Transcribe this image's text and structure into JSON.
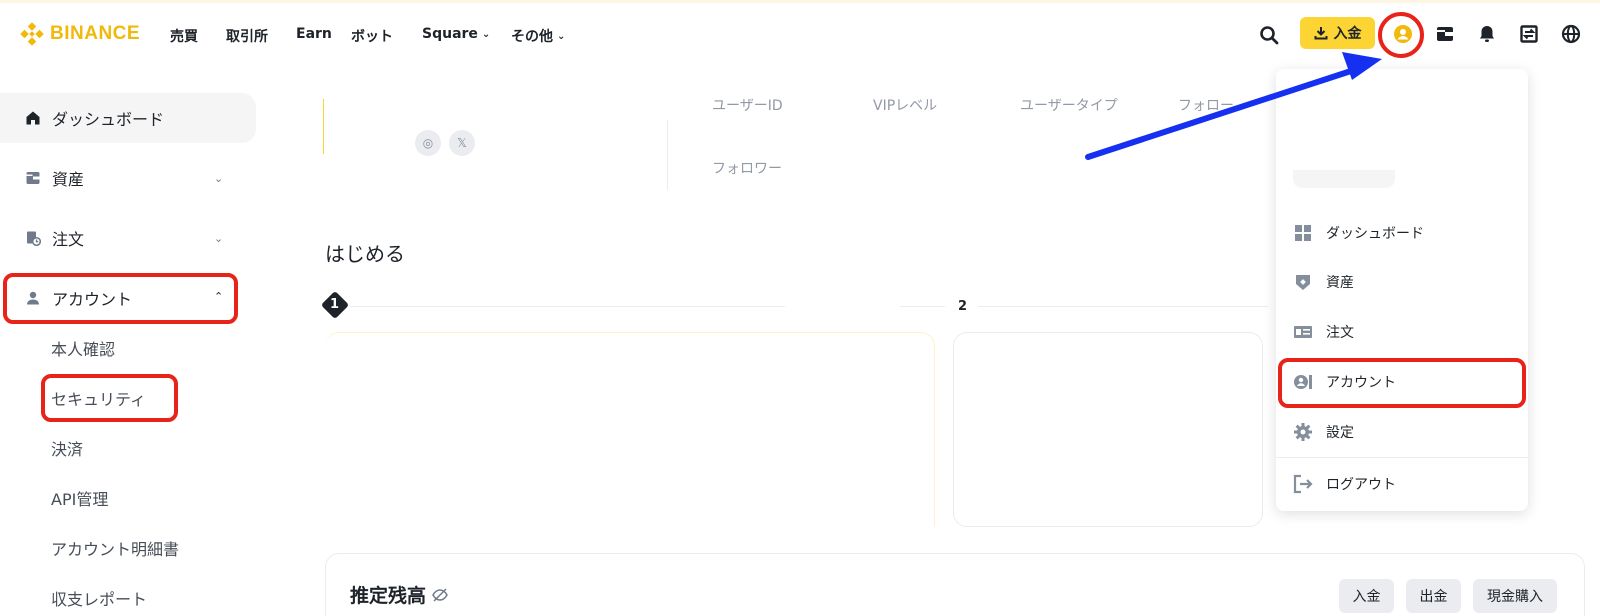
{
  "brand": {
    "name": "BINANCE",
    "color": "#f0b90b"
  },
  "nav": {
    "items": [
      {
        "label": "売買",
        "has_dropdown": false
      },
      {
        "label": "取引所",
        "has_dropdown": false
      },
      {
        "label": "Earn",
        "has_dropdown": false
      },
      {
        "label": "ボット",
        "has_dropdown": false
      },
      {
        "label": "Square",
        "has_dropdown": true
      },
      {
        "label": "その他",
        "has_dropdown": true
      }
    ],
    "deposit_label": "入金",
    "icons": [
      "search-icon",
      "download-icon",
      "user-icon",
      "wallet-icon",
      "bell-icon",
      "transfer-icon",
      "globe-icon"
    ]
  },
  "sidebar": {
    "items": [
      {
        "label": "ダッシュボード",
        "icon": "home-icon",
        "active": true,
        "chevron": ""
      },
      {
        "label": "資産",
        "icon": "wallet-icon",
        "active": false,
        "chevron": "⌄"
      },
      {
        "label": "注文",
        "icon": "order-icon",
        "active": false,
        "chevron": "⌄"
      },
      {
        "label": "アカウント",
        "icon": "user-icon",
        "active": false,
        "chevron": "⌃"
      }
    ],
    "sub_items": [
      "本人確認",
      "セキュリティ",
      "決済",
      "API管理",
      "アカウント明細書",
      "収支レポート"
    ]
  },
  "profile": {
    "labels": [
      "ユーザーID",
      "VIPレベル",
      "ユーザータイプ",
      "フォロー",
      "フォロワー"
    ]
  },
  "getting_started": {
    "title": "はじめる",
    "steps": [
      "1",
      "2"
    ]
  },
  "balance": {
    "title": "推定残高",
    "buttons": [
      "入金",
      "出金",
      "現金購入"
    ]
  },
  "dropdown": {
    "items": [
      {
        "label": "ダッシュボード",
        "icon": "grid-icon"
      },
      {
        "label": "資産",
        "icon": "shield-wallet-icon"
      },
      {
        "label": "注文",
        "icon": "id-card-icon"
      },
      {
        "label": "アカウント",
        "icon": "account-icon"
      },
      {
        "label": "設定",
        "icon": "gear-icon"
      },
      {
        "label": "ログアウト",
        "icon": "logout-icon"
      }
    ]
  },
  "colors": {
    "accent_yellow": "#fcd535",
    "annotation_red": "#e8231a",
    "annotation_arrow_blue": "#1530f0"
  }
}
